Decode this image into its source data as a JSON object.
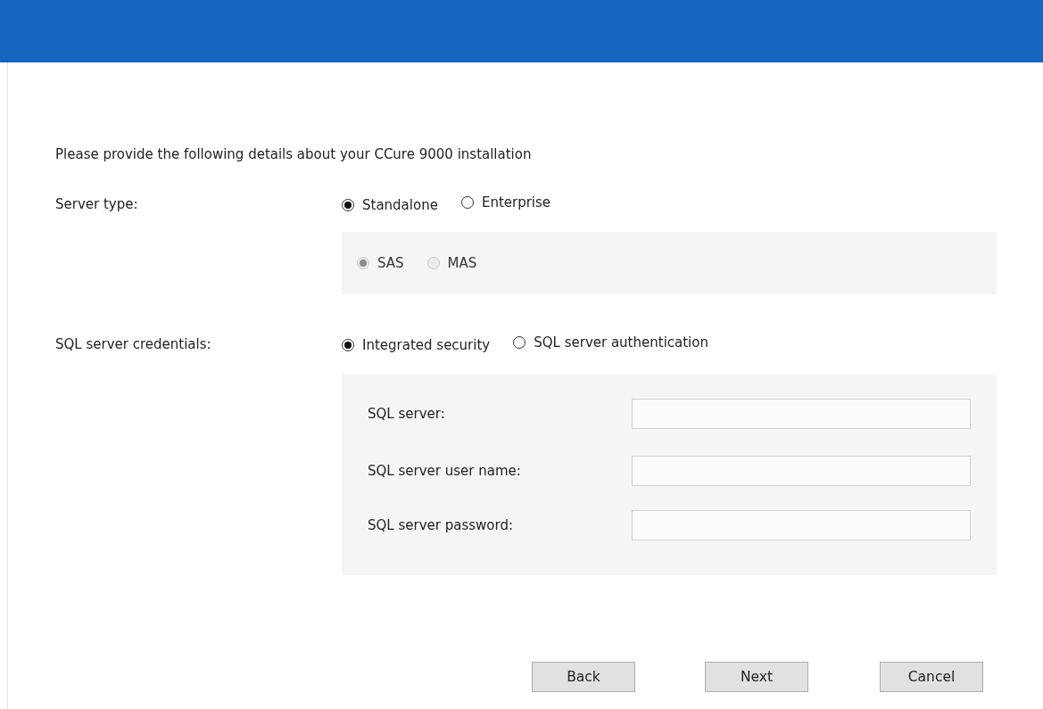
{
  "intro": "Please provide the following details about your CCure 9000 installation",
  "server_type": {
    "label": "Server type:",
    "options": [
      {
        "label": "Standalone",
        "selected": true,
        "disabled": false
      },
      {
        "label": "Enterprise",
        "selected": false,
        "disabled": false
      }
    ],
    "sub_options": [
      {
        "label": "SAS",
        "selected": true,
        "disabled": true
      },
      {
        "label": "MAS",
        "selected": false,
        "disabled": true
      }
    ]
  },
  "credentials": {
    "label": "SQL server credentials:",
    "options": [
      {
        "label": "Integrated security",
        "selected": true,
        "disabled": false
      },
      {
        "label": "SQL server authentication",
        "selected": false,
        "disabled": false
      }
    ],
    "fields": [
      {
        "label": "SQL server:",
        "disabled": false
      },
      {
        "label": "SQL server user name:",
        "disabled": false
      },
      {
        "label": "SQL server password:",
        "disabled": false
      }
    ]
  },
  "buttons": [
    "Back",
    "Next",
    "Cancel"
  ]
}
